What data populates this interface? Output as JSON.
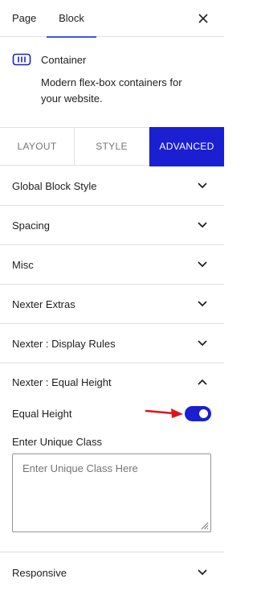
{
  "top_tabs": {
    "page": "Page",
    "block": "Block",
    "close_icon": "close-icon"
  },
  "block_card": {
    "icon": "container-icon",
    "title": "Container",
    "description": "Modern flex-box containers for your website."
  },
  "segment_tabs": {
    "layout": "LAYOUT",
    "style": "STYLE",
    "advanced": "ADVANCED",
    "active": "ADVANCED"
  },
  "panels": [
    {
      "label": "Global Block Style",
      "state": "collapsed"
    },
    {
      "label": "Spacing",
      "state": "collapsed"
    },
    {
      "label": "Misc",
      "state": "collapsed"
    },
    {
      "label": "Nexter Extras",
      "state": "collapsed"
    },
    {
      "label": "Nexter : Display Rules",
      "state": "collapsed"
    }
  ],
  "equal_height_panel": {
    "label": "Nexter : Equal Height",
    "state": "expanded",
    "toggle_label": "Equal Height",
    "toggle_on": true,
    "unique_class_label": "Enter Unique Class",
    "unique_class_placeholder": "Enter Unique Class Here",
    "unique_class_value": ""
  },
  "responsive_panel": {
    "label": "Responsive",
    "state": "collapsed"
  },
  "colors": {
    "accent": "#1a1fd1",
    "tab_underline": "#3858e9",
    "arrow": "#e0121f",
    "border": "#e0e0e0"
  }
}
